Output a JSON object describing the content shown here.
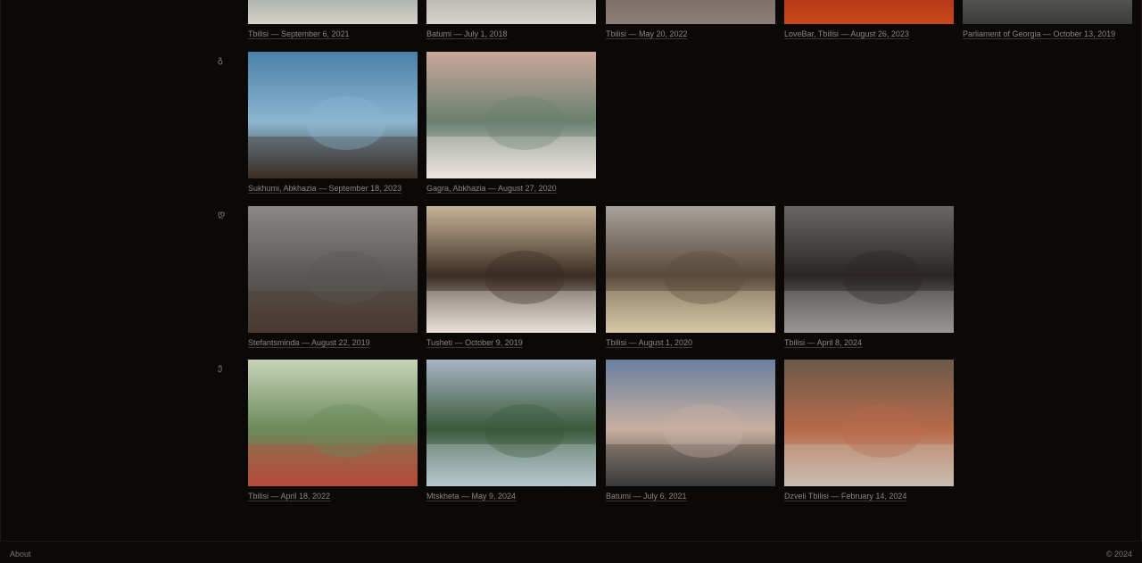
{
  "rows": [
    {
      "letter": "",
      "photos": [
        {
          "caption": "Tbilisi — September 6, 2021",
          "palette": [
            "#8a9aa6",
            "#4a6a80",
            "#d8d2c6"
          ]
        },
        {
          "caption": "Batumi — July 1, 2018",
          "palette": [
            "#b8b4ae",
            "#7d7a76",
            "#d6d3cf"
          ]
        },
        {
          "caption": "Tbilisi — May 20, 2022",
          "palette": [
            "#2a2422",
            "#5a4d48",
            "#8c7f78"
          ]
        },
        {
          "caption": "LoveBar, Tbilisi — August 26, 2023",
          "palette": [
            "#2a0a06",
            "#8a1a0c",
            "#c9481c"
          ]
        },
        {
          "caption": "Parliament of Georgia — October 13, 2019",
          "palette": [
            "#6a6a66",
            "#9a9a94",
            "#3a3a38"
          ]
        }
      ]
    },
    {
      "letter": "გ",
      "photos": [
        {
          "caption": "Sukhumi, Abkhazia — September 18, 2023",
          "palette": [
            "#4a80a8",
            "#8cb6d0",
            "#3a2e26"
          ]
        },
        {
          "caption": "Gagra, Abkhazia — August 27, 2020",
          "palette": [
            "#c9a89a",
            "#6a8070",
            "#efe6e0"
          ]
        }
      ]
    },
    {
      "letter": "დ",
      "photos": [
        {
          "caption": "Stefantsminda — August 22, 2019",
          "palette": [
            "#8a8886",
            "#5a5856",
            "#4a3a30"
          ]
        },
        {
          "caption": "Tusheti — October 9, 2019",
          "palette": [
            "#c8b498",
            "#3a2c22",
            "#e8e2da"
          ]
        },
        {
          "caption": "Tbilisi — August 1, 2020",
          "palette": [
            "#a6a29c",
            "#5a4a3a",
            "#d8c8a8"
          ]
        },
        {
          "caption": "Tbilisi — April 8, 2024",
          "palette": [
            "#6a6664",
            "#2a2624",
            "#9a9894"
          ]
        }
      ]
    },
    {
      "letter": "ე",
      "photos": [
        {
          "caption": "Tbilisi — April 18, 2022",
          "palette": [
            "#c8d4b8",
            "#6a8a5a",
            "#b84a3a"
          ]
        },
        {
          "caption": "Mtskheta — May 9, 2024",
          "palette": [
            "#a8b4c4",
            "#3a5a3a",
            "#b8c8d0"
          ]
        },
        {
          "caption": "Batumi — July 6, 2021",
          "palette": [
            "#6a80a0",
            "#c8b0a0",
            "#3a3a3a"
          ]
        },
        {
          "caption": "Dzveli Tbilisi — February 14, 2024",
          "palette": [
            "#6a5a4a",
            "#b86a4a",
            "#c8bcb0"
          ]
        }
      ]
    }
  ],
  "footer": {
    "about": "About",
    "copyright": "© 2024"
  }
}
